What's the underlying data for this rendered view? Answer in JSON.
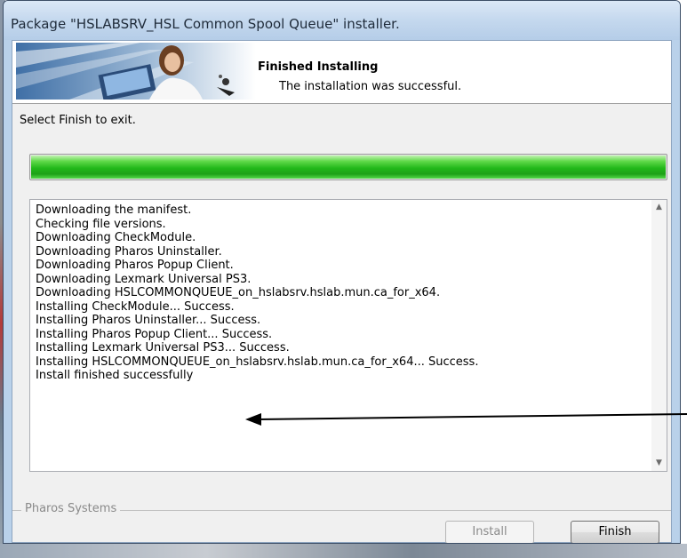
{
  "window": {
    "title": "Package \"HSLABSRV_HSL Common Spool Queue\" installer."
  },
  "banner": {
    "heading": "Finished Installing",
    "subheading": "The installation was successful."
  },
  "status": {
    "label": "Select Finish to exit.",
    "progress_fraction": 1.0,
    "progress_color": "#22b81a"
  },
  "log": {
    "lines": [
      "Downloading the manifest.",
      "Checking file versions.",
      "Downloading CheckModule.",
      "Downloading Pharos Uninstaller.",
      "Downloading Pharos Popup Client.",
      "Downloading Lexmark Universal PS3.",
      "Downloading HSLCOMMONQUEUE_on_hslabsrv.hslab.mun.ca_for_x64.",
      "Installing CheckModule... Success.",
      "Installing Pharos Uninstaller... Success.",
      "Installing Pharos Popup Client... Success.",
      "Installing Lexmark Universal PS3... Success.",
      "Installing HSLCOMMONQUEUE_on_hslabsrv.hslab.mun.ca_for_x64... Success.",
      "Install finished successfully"
    ]
  },
  "footer": {
    "group_label": "Pharos Systems",
    "install_label": "Install",
    "finish_label": "Finish"
  },
  "icons": {
    "scroll_up": "scroll-up-arrow-icon",
    "scroll_down": "scroll-down-arrow-icon",
    "annotation": "pointer-arrow-icon"
  }
}
